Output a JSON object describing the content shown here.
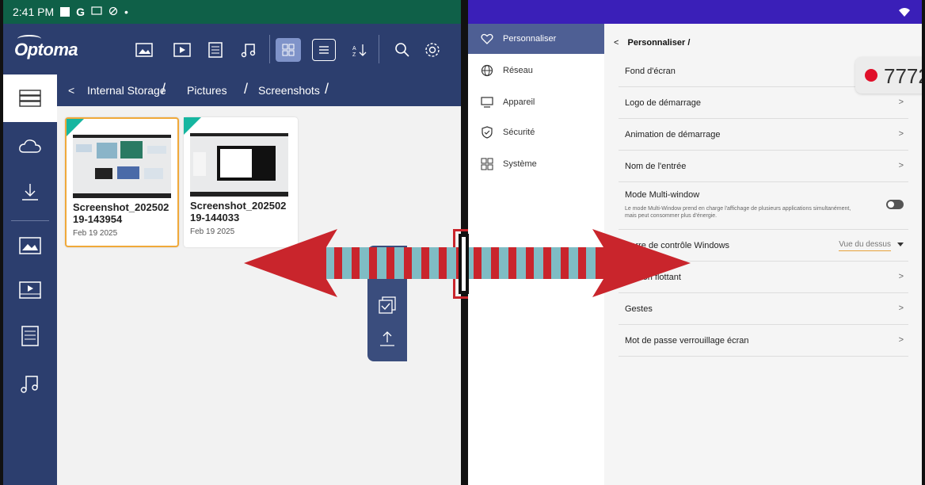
{
  "left_app": {
    "status": {
      "time": "2:41 PM",
      "g": "G"
    },
    "logo": "Optoma",
    "breadcrumb": {
      "back": "<",
      "items": [
        "Internal Storage",
        "Pictures",
        "Screenshots"
      ],
      "separators": [
        "/",
        "/",
        "/"
      ]
    },
    "toolbar_icons": [
      "image-icon",
      "video-icon",
      "document-icon",
      "music-icon",
      "grid-view-icon",
      "list-view-icon",
      "sort-icon",
      "search-icon",
      "settings-icon"
    ],
    "sidebar_icons": [
      "storage-icon",
      "cloud-icon",
      "download-icon",
      "image-icon",
      "video-icon",
      "document-icon",
      "music-icon"
    ],
    "files": [
      {
        "name": "Screenshot_20250219-143954",
        "name_line1": "Screenshot_202502",
        "name_line2": "19-143954",
        "date": "Feb 19 2025",
        "selected": true
      },
      {
        "name": "Screenshot_20250219-144033",
        "name_line1": "Screenshot_202502",
        "name_line2": "19-144033",
        "date": "Feb 19 2025",
        "selected": false
      }
    ],
    "colors": {
      "header": "#2c3e6e",
      "status": "#0f6048",
      "accent": "#16b6a0",
      "selected_border": "#f0a93a"
    }
  },
  "right_app": {
    "nav": [
      {
        "label": "Personnaliser",
        "icon": "heart-icon",
        "active": true
      },
      {
        "label": "Réseau",
        "icon": "globe-icon",
        "active": false
      },
      {
        "label": "Appareil",
        "icon": "monitor-icon",
        "active": false
      },
      {
        "label": "Sécurité",
        "icon": "shield-icon",
        "active": false
      },
      {
        "label": "Système",
        "icon": "grid-icon",
        "active": false
      }
    ],
    "settings_title": "Personnaliser /",
    "settings_back": "<",
    "rows": [
      {
        "label": "Fond d'écran",
        "chev": ">"
      },
      {
        "label": "Logo de démarrage",
        "chev": ">"
      },
      {
        "label": "Animation de démarrage",
        "chev": ">"
      },
      {
        "label": "Nom de l'entrée",
        "chev": ">"
      },
      {
        "label": "Mode Multi-window",
        "desc": "Le mode Multi-Window prend en charge l'affichage de plusieurs applications simultanément, mais peut consommer plus d'énergie.",
        "toggle": false
      },
      {
        "label": "Barre de contrôle Windows",
        "value": "Vue du dessus"
      },
      {
        "label": "Bouton flottant",
        "chev": ">"
      },
      {
        "label": "Gestes",
        "chev": ">"
      },
      {
        "label": "Mot de passe verrouillage écran",
        "chev": ">"
      }
    ],
    "overlay": {
      "code": "7772"
    },
    "colors": {
      "status": "#3a1fb8",
      "nav_active": "#4e5f94",
      "record": "#e0102a"
    }
  },
  "annotation": {
    "colors": {
      "arrow": "#c9252c",
      "stripe": "#7fbcc4"
    }
  }
}
